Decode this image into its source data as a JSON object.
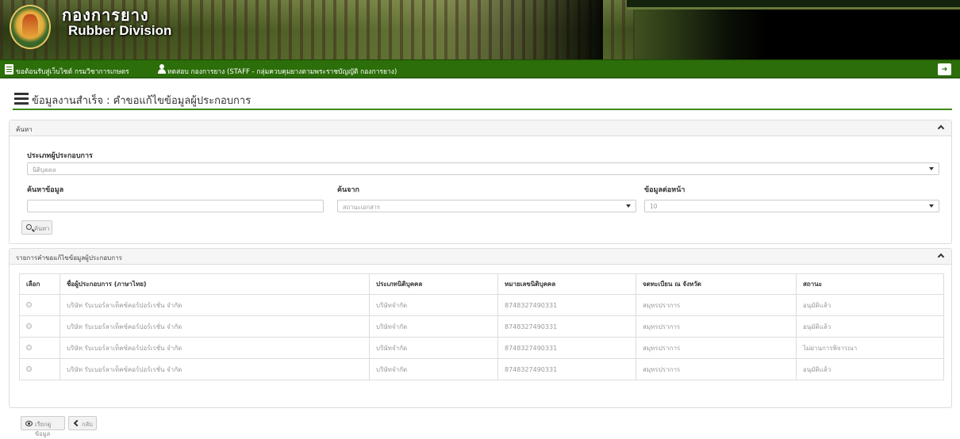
{
  "header": {
    "brand_thai": "กองการยาง",
    "brand_en": "Rubber Division",
    "logo_icon": "department-seal-logo"
  },
  "statusbar": {
    "welcome": "ขอต้อนรับสู่เว็บไซต์ กรมวิชาการเกษตร",
    "username": "ทดสอบ กองการยาง (STAFF - กลุ่มควบคุมยางตามพระราชบัญญัติ กองการยาง)",
    "logout_icon": "sign-out-icon"
  },
  "page": {
    "title": "ข้อมูลงานสำเร็จ : คำขอแก้ไขข้อมูลผู้ประกอบการ"
  },
  "search_panel": {
    "title": "ค้นหา",
    "operator_type_label": "ประเภทผู้ประกอบการ",
    "operator_type_value": "นิติบุคคล",
    "keyword_label": "ค้นหาข้อมูล",
    "keyword_value": "",
    "search_from_label": "ค้นจาก",
    "search_from_value": "สถานะเอกสาร",
    "per_page_label": "ข้อมูลต่อหน้า",
    "per_page_value": "10",
    "search_button": "ค้นหา"
  },
  "list_panel": {
    "title": "รายการคำขอแก้ไขข้อมูลผู้ประกอบการ",
    "columns": [
      "เลือก",
      "ชื่อผู้ประกอบการ (ภาษาไทย)",
      "ประเภทนิติบุคคล",
      "หมายเลขนิติบุคคล",
      "จดทะเบียน ณ จังหวัด",
      "สถานะ"
    ],
    "rows": [
      [
        "บริษัท รับเบอร์ลาเท็คซ์คอร์ปอร์เรชั่น จำกัด",
        "บริษัทจำกัด",
        "8748327490331",
        "สมุทรปราการ",
        "อนุมัติแล้ว"
      ],
      [
        "บริษัท รับเบอร์ลาเท็คซ์คอร์ปอร์เรชั่น จำกัด",
        "บริษัทจำกัด",
        "8748327490331",
        "สมุทรปราการ",
        "อนุมัติแล้ว"
      ],
      [
        "บริษัท รับเบอร์ลาเท็คซ์คอร์ปอร์เรชั่น จำกัด",
        "บริษัทจำกัด",
        "8748327490331",
        "สมุทรปราการ",
        "ไม่ผ่านการพิจารณา"
      ],
      [
        "บริษัท รับเบอร์ลาเท็คซ์คอร์ปอร์เรชั่น จำกัด",
        "บริษัทจำกัด",
        "8748327490331",
        "สมุทรปราการ",
        "อนุมัติแล้ว"
      ]
    ]
  },
  "footer": {
    "view_button": "เรียกดูข้อมูล",
    "back_button": "กลับ"
  },
  "colors": {
    "statusbar_green": "#2c6e0a",
    "title_underline": "#3d8b14"
  }
}
